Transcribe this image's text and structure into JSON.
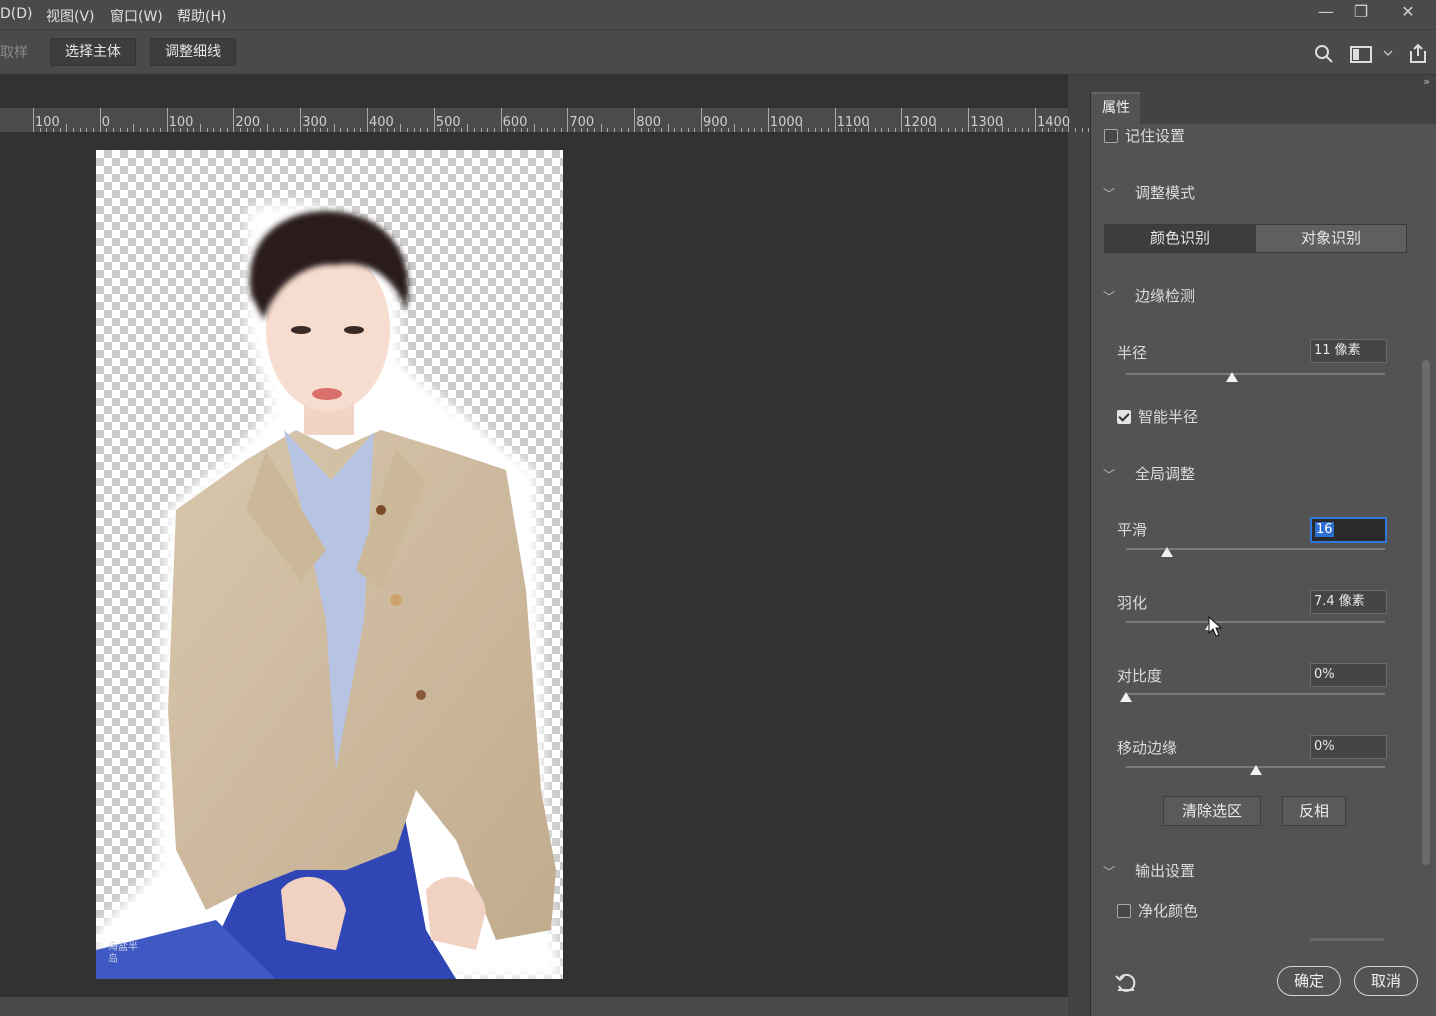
{
  "menu": {
    "items": [
      "D(D)",
      "视图(V)",
      "窗口(W)",
      "帮助(H)"
    ]
  },
  "window": {
    "minimize": "—",
    "restore": "❐",
    "close": "✕"
  },
  "options": {
    "partial_label": "取样",
    "select_subject": "选择主体",
    "refine_hair": "调整细线"
  },
  "ruler": {
    "labels": [
      "100",
      "0",
      "100",
      "200",
      "300",
      "400",
      "500",
      "600",
      "700",
      "800",
      "900",
      "1000",
      "1100",
      "1200",
      "1300",
      "1400"
    ]
  },
  "photo": {
    "watermark": "海盐半岛"
  },
  "panel": {
    "tab": "属性",
    "remember_settings": "记住设置",
    "remember_checked": false,
    "section_adjust_mode": "调整模式",
    "mode_color": "颜色识别",
    "mode_object": "对象识别",
    "section_edge_detection": "边缘检测",
    "radius_label": "半径",
    "radius_value": "11 像素",
    "radius_level": 0.41,
    "smart_radius": "智能半径",
    "smart_radius_checked": true,
    "section_global": "全局调整",
    "smooth_label": "平滑",
    "smooth_value": "16",
    "smooth_level": 0.16,
    "feather_label": "羽化",
    "feather_value": "7.4 像素",
    "feather_level": 0.33,
    "contrast_label": "对比度",
    "contrast_value": "0%",
    "contrast_level": 0.0,
    "shift_edge_label": "移动边缘",
    "shift_edge_value": "0%",
    "shift_edge_level": 0.5,
    "clear_selection": "清除选区",
    "invert": "反相",
    "section_output": "输出设置",
    "decontaminate": "净化颜色",
    "decontaminate_checked": false,
    "ok": "确定",
    "cancel": "取消"
  }
}
